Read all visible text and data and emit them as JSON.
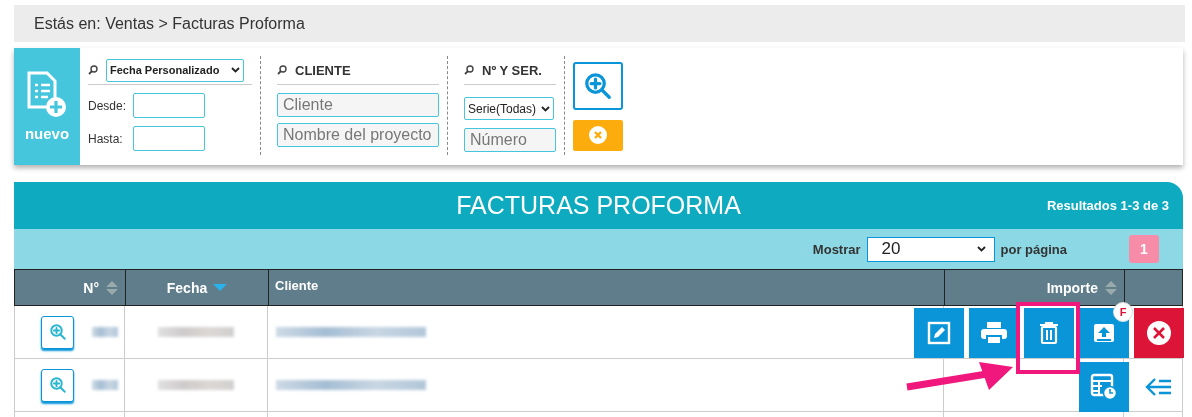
{
  "breadcrumb": "Estás en: Ventas > Facturas Proforma",
  "new_button": {
    "label": "nuevo"
  },
  "filters": {
    "date_select": "Fecha Personalizado",
    "from_label": "Desde:",
    "to_label": "Hasta:",
    "client_heading": "CLIENTE",
    "client_placeholder": "Cliente",
    "project_placeholder": "Nombre del proyecto",
    "series_heading": "Nº Y SER.",
    "series_select": "Serie(Todas)",
    "number_placeholder": "Número"
  },
  "table": {
    "title": "FACTURAS PROFORMA",
    "results": "Resultados 1-3 de 3",
    "show_label": "Mostrar",
    "page_size": "20",
    "per_page_label": "por página",
    "pages": [
      {
        "label": "1",
        "selected": true
      }
    ],
    "columns": [
      {
        "label": "N°",
        "kind": "sortable"
      },
      {
        "label": "Fecha",
        "kind": "sorted-desc"
      },
      {
        "label": "Cliente",
        "kind": "plain"
      },
      {
        "label": "Importe",
        "kind": "sortable"
      }
    ],
    "rows": [
      {
        "kind": "blurred"
      },
      {
        "kind": "blurred"
      }
    ],
    "actions": [
      {
        "kind": "edit"
      },
      {
        "kind": "print"
      },
      {
        "kind": "delete"
      },
      {
        "kind": "upload",
        "badge": "F"
      },
      {
        "kind": "cancel"
      },
      {
        "kind": "schedule"
      },
      {
        "kind": "back"
      }
    ]
  },
  "annotations": {
    "highlight_box": true,
    "arrow": true
  }
}
